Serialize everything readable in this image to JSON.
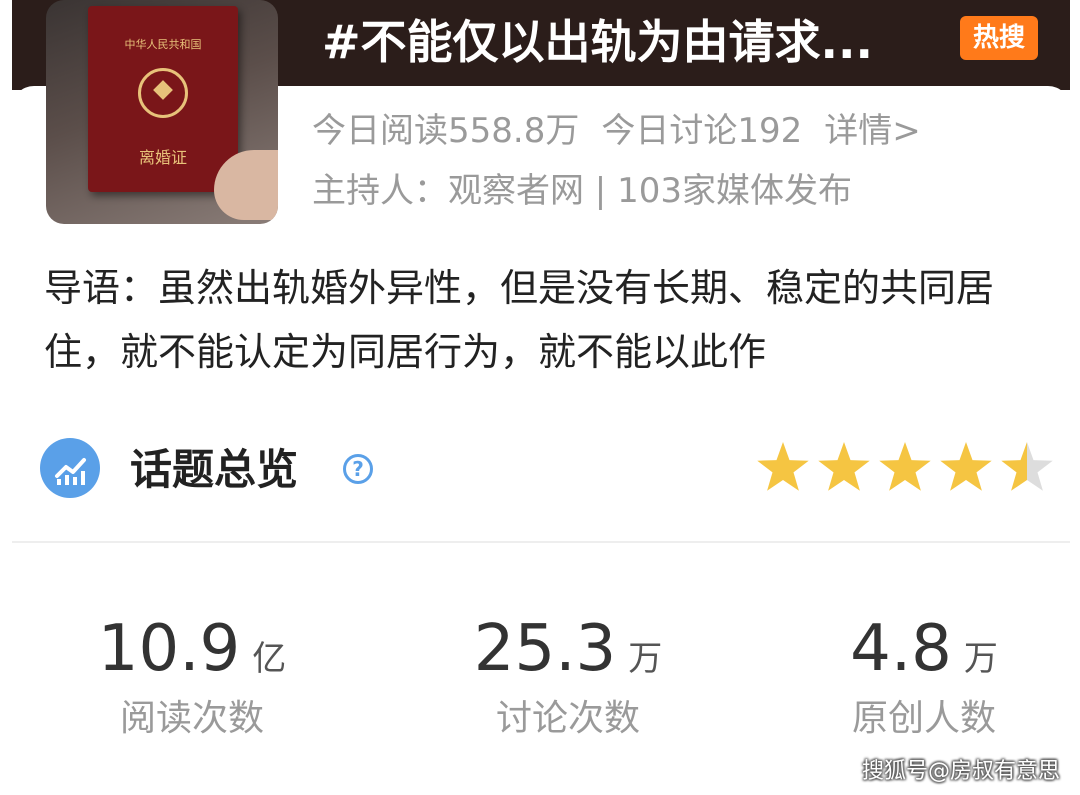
{
  "topic": {
    "title": "#不能仅以出轨为由请求...",
    "hot_badge": "热搜",
    "cover": {
      "book_top": "中华人民共和国",
      "book_bottom": "离婚证"
    },
    "today_reads": "今日阅读558.8万",
    "today_discussions": "今日讨论192",
    "details_link": "详情>",
    "host": "主持人：观察者网 | 103家媒体发布",
    "intro": "导语：虽然出轨婚外异性，但是没有长期、稳定的共同居住，就不能认定为同居行为，就不能以此作"
  },
  "overview": {
    "title": "话题总览",
    "help_glyph": "?",
    "rating": 4.5,
    "rating_max": 5,
    "star_color": "#f5c542",
    "star_empty_color": "#dddddd"
  },
  "metrics": [
    {
      "value": "10.9",
      "unit": "亿",
      "label": "阅读次数"
    },
    {
      "value": "25.3",
      "unit": "万",
      "label": "讨论次数"
    },
    {
      "value": "4.8",
      "unit": "万",
      "label": "原创人数"
    }
  ],
  "watermark": "搜狐号@房叔有意思",
  "colors": {
    "banner": "#2b1d1a",
    "hot_badge": "#ff7a1a",
    "accent_blue": "#5aa0e8"
  }
}
